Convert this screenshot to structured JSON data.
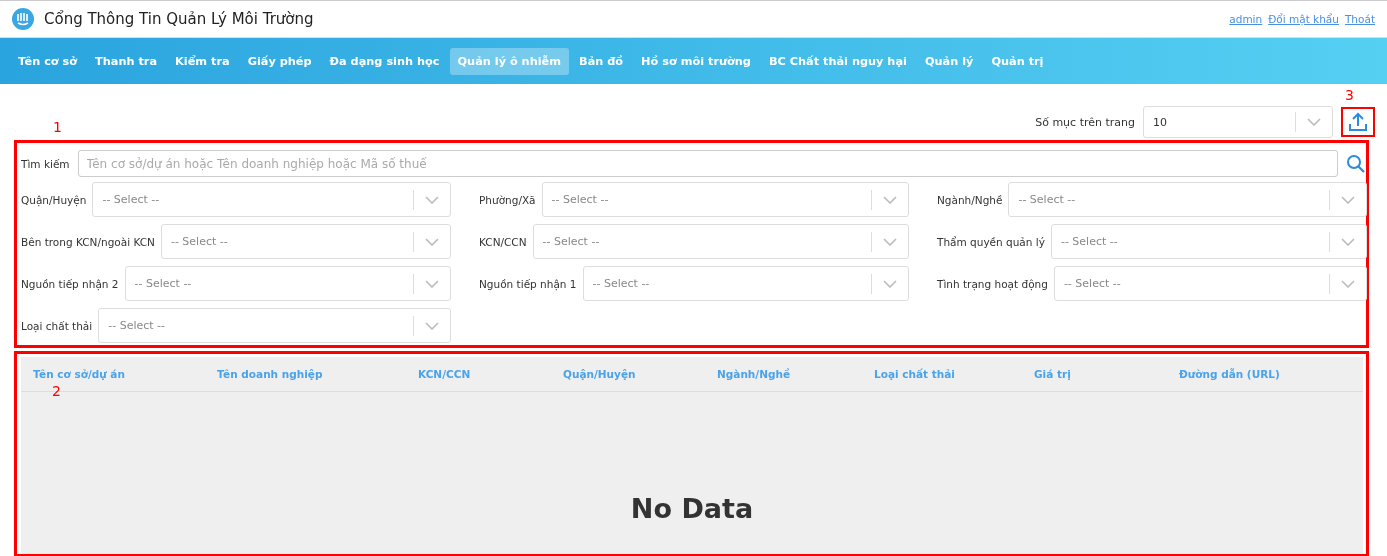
{
  "header": {
    "title": "Cổng Thông Tin Quản Lý Môi Trường",
    "links": [
      "admin",
      "Đổi mật khẩu",
      "Thoát"
    ]
  },
  "nav": [
    {
      "label": "Tên cơ sở",
      "selected": false
    },
    {
      "label": "Thanh tra",
      "selected": false
    },
    {
      "label": "Kiểm tra",
      "selected": false
    },
    {
      "label": "Giấy phép",
      "selected": false
    },
    {
      "label": "Đa dạng sinh học",
      "selected": false
    },
    {
      "label": "Quản lý ô nhiễm",
      "selected": true
    },
    {
      "label": "Bản đồ",
      "selected": false
    },
    {
      "label": "Hồ sơ môi trường",
      "selected": false
    },
    {
      "label": "BC Chất thải nguy hại",
      "selected": false
    },
    {
      "label": "Quản lý",
      "selected": false
    },
    {
      "label": "Quản trị",
      "selected": false
    }
  ],
  "page_size": {
    "label": "Số mục trên trang",
    "value": "10"
  },
  "annotations": [
    "1",
    "2",
    "3"
  ],
  "search": {
    "label": "Tìm kiếm",
    "placeholder": "Tên cơ sở/dự án hoặc Tên doanh nghiệp hoặc Mã số thuế"
  },
  "filters": [
    {
      "label": "Quận/Huyện",
      "placeholder": "-- Select --"
    },
    {
      "label": "Phường/Xã",
      "placeholder": "-- Select --"
    },
    {
      "label": "Ngành/Nghề",
      "placeholder": "-- Select --"
    },
    {
      "label": "Bên trong KCN/ngoài KCN",
      "placeholder": "-- Select --"
    },
    {
      "label": "KCN/CCN",
      "placeholder": "-- Select --"
    },
    {
      "label": "Thẩm quyền quản lý",
      "placeholder": "-- Select --"
    },
    {
      "label": "Nguồn tiếp nhận 2",
      "placeholder": "-- Select --"
    },
    {
      "label": "Nguồn tiếp nhận 1",
      "placeholder": "-- Select --"
    },
    {
      "label": "Tình trạng hoạt động",
      "placeholder": "-- Select --"
    },
    {
      "label": "Loại chất thải",
      "placeholder": "-- Select --"
    }
  ],
  "table": {
    "columns": [
      "Tên cơ sở/dự án",
      "Tên doanh nghiệp",
      "KCN/CCN",
      "Quận/Huyện",
      "Ngành/Nghề",
      "Loại chất thải",
      "Giá trị",
      "Đường dẫn (URL)"
    ],
    "empty_text": "No Data"
  }
}
